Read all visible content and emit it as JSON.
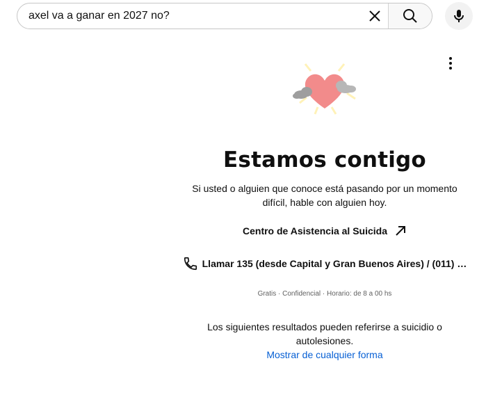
{
  "search": {
    "query": "axel va a ganar en 2027 no?",
    "clear_icon": "close-icon",
    "search_icon": "search-icon",
    "mic_icon": "microphone-icon"
  },
  "menu": {
    "icon": "more-vertical-icon"
  },
  "panel": {
    "illustration": "heart-with-clouds-icon",
    "title": "Estamos contigo",
    "description": "Si usted o alguien que conoce está pasando por un momento difícil, hable con alguien hoy.",
    "center_link": "Centro de Asistencia al Suicida",
    "center_link_icon": "external-arrow-icon",
    "call_icon": "phone-icon",
    "call_text": "Llamar 135 (desde Capital y Gran Buenos Aires) / (011) …",
    "meta": "Gratis · Confidencial · Horario: de 8 a 00 hs",
    "results_note": "Los siguientes resultados pueden referirse a suicidio o autolesiones.",
    "show_anyway": "Mostrar de cualquier forma"
  },
  "colors": {
    "link": "#065fd4",
    "text": "#0f0f0f",
    "heart": "#f28b8b"
  }
}
